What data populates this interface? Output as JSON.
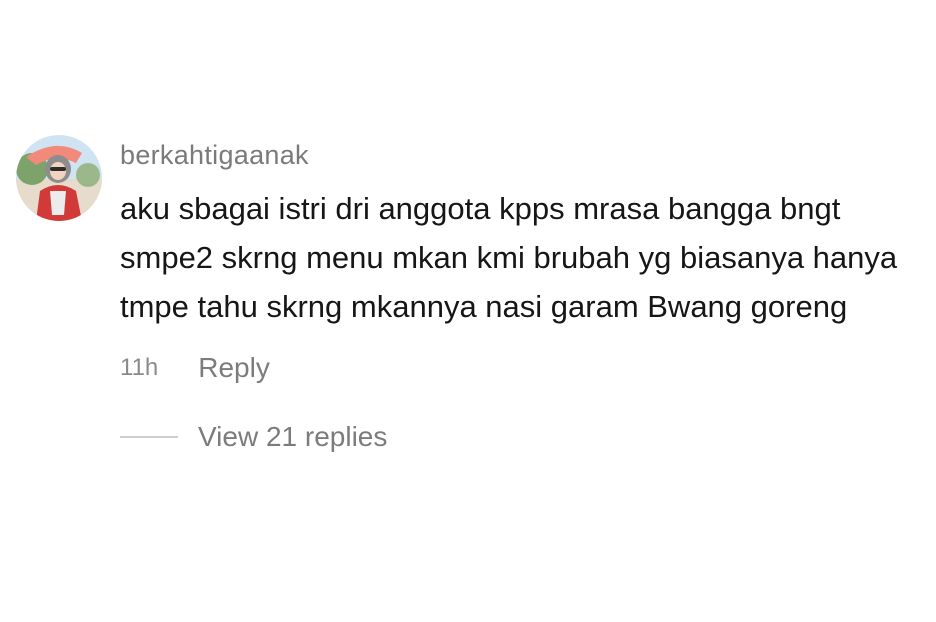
{
  "comment": {
    "username": "berkahtigaanak",
    "text": "aku sbagai istri dri anggota kpps mrasa bangga bngt smpe2 skrng menu mkan kmi brubah yg biasanya hanya tmpe tahu skrng mkannya nasi garam Bwang goreng",
    "timestamp": "11h",
    "reply_label": "Reply",
    "view_replies_label": "View 21 replies"
  },
  "colors": {
    "username": "#7a7a7a",
    "text": "#161616",
    "muted": "#7c7c7c",
    "divider": "#cfcfcf"
  }
}
